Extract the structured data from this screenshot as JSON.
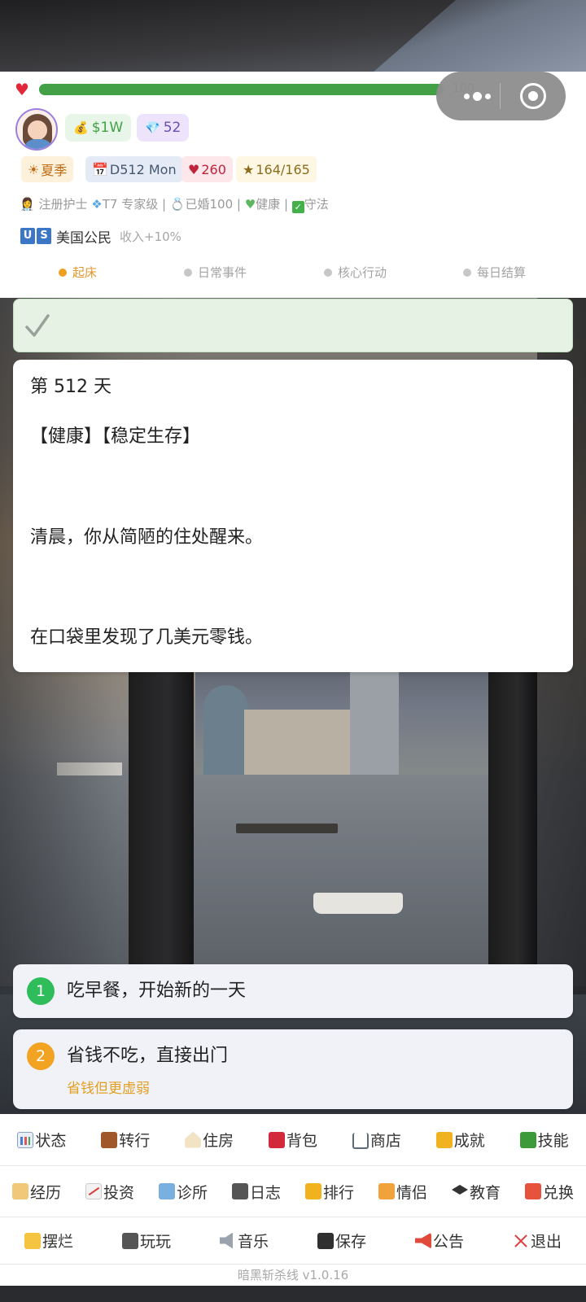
{
  "hp": {
    "value": 100,
    "max": 100,
    "label": "100"
  },
  "resources": {
    "money": "$1W",
    "gems": "52"
  },
  "tags": {
    "season": "夏季",
    "day": "D512 Mon",
    "health": "260",
    "stars": "164/165"
  },
  "profile": {
    "info_line": {
      "job": "注册护士",
      "rank": "T7 专家级",
      "marriage": "已婚100",
      "health": "健康",
      "law": "守法"
    },
    "citizenship": {
      "flag": [
        "U",
        "S"
      ],
      "name": "美国公民",
      "bonus": "收入+10%"
    }
  },
  "steps": [
    {
      "label": "起床",
      "active": true
    },
    {
      "label": "日常事件",
      "active": false
    },
    {
      "label": "核心行动",
      "active": false
    },
    {
      "label": "每日结算",
      "active": false
    }
  ],
  "story": {
    "day": "第 512 天",
    "tags": "【健康】【稳定生存】",
    "line1": "清晨，你从简陋的住处醒来。",
    "line2": "在口袋里发现了几美元零钱。"
  },
  "choices": [
    {
      "num": "1",
      "text": "吃早餐，开始新的一天"
    },
    {
      "num": "2",
      "text": "省钱不吃，直接出门",
      "hint": "省钱但更虚弱"
    }
  ],
  "menu": {
    "row1": [
      "状态",
      "转行",
      "住房",
      "背包",
      "商店",
      "成就",
      "技能"
    ],
    "row2": [
      "经历",
      "投资",
      "诊所",
      "日志",
      "排行",
      "情侣",
      "教育",
      "兑换"
    ],
    "row3": [
      "摆烂",
      "玩玩",
      "音乐",
      "保存",
      "公告",
      "退出"
    ]
  },
  "version": "暗黑斩杀线 v1.0.16",
  "colors": {
    "hp_bar": "#43a047",
    "active_step": "#f0a020",
    "heart": "#e0283a"
  }
}
